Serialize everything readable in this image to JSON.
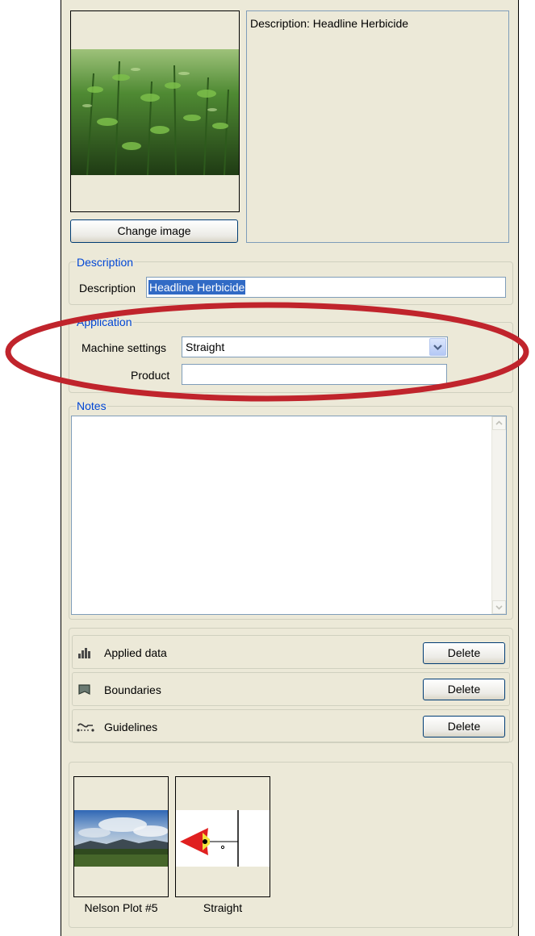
{
  "top": {
    "description_preview": "Description: Headline Herbicide",
    "change_image_button": "Change image"
  },
  "description_group": {
    "legend": "Description",
    "field_label": "Description",
    "field_value": "Headline Herbicide"
  },
  "application_group": {
    "legend": "Application",
    "machine_settings_label": "Machine settings",
    "machine_settings_value": "Straight",
    "product_label": "Product",
    "product_value": ""
  },
  "notes_group": {
    "legend": "Notes",
    "text": ""
  },
  "data_rows": [
    {
      "label": "Applied data",
      "icon": "bar-chart-icon",
      "button": "Delete"
    },
    {
      "label": "Boundaries",
      "icon": "boundary-icon",
      "button": "Delete"
    },
    {
      "label": "Guidelines",
      "icon": "guideline-icon",
      "button": "Delete"
    }
  ],
  "thumbnails": [
    {
      "caption": "Nelson Plot #5",
      "image": "field-landscape-photo"
    },
    {
      "caption": "Straight",
      "image": "straight-guidance-diagram"
    }
  ],
  "colors": {
    "panel": "#ece9d8",
    "legend_text": "#0046d5",
    "highlight_ellipse": "#c0242c",
    "selection": "#316ac5"
  }
}
